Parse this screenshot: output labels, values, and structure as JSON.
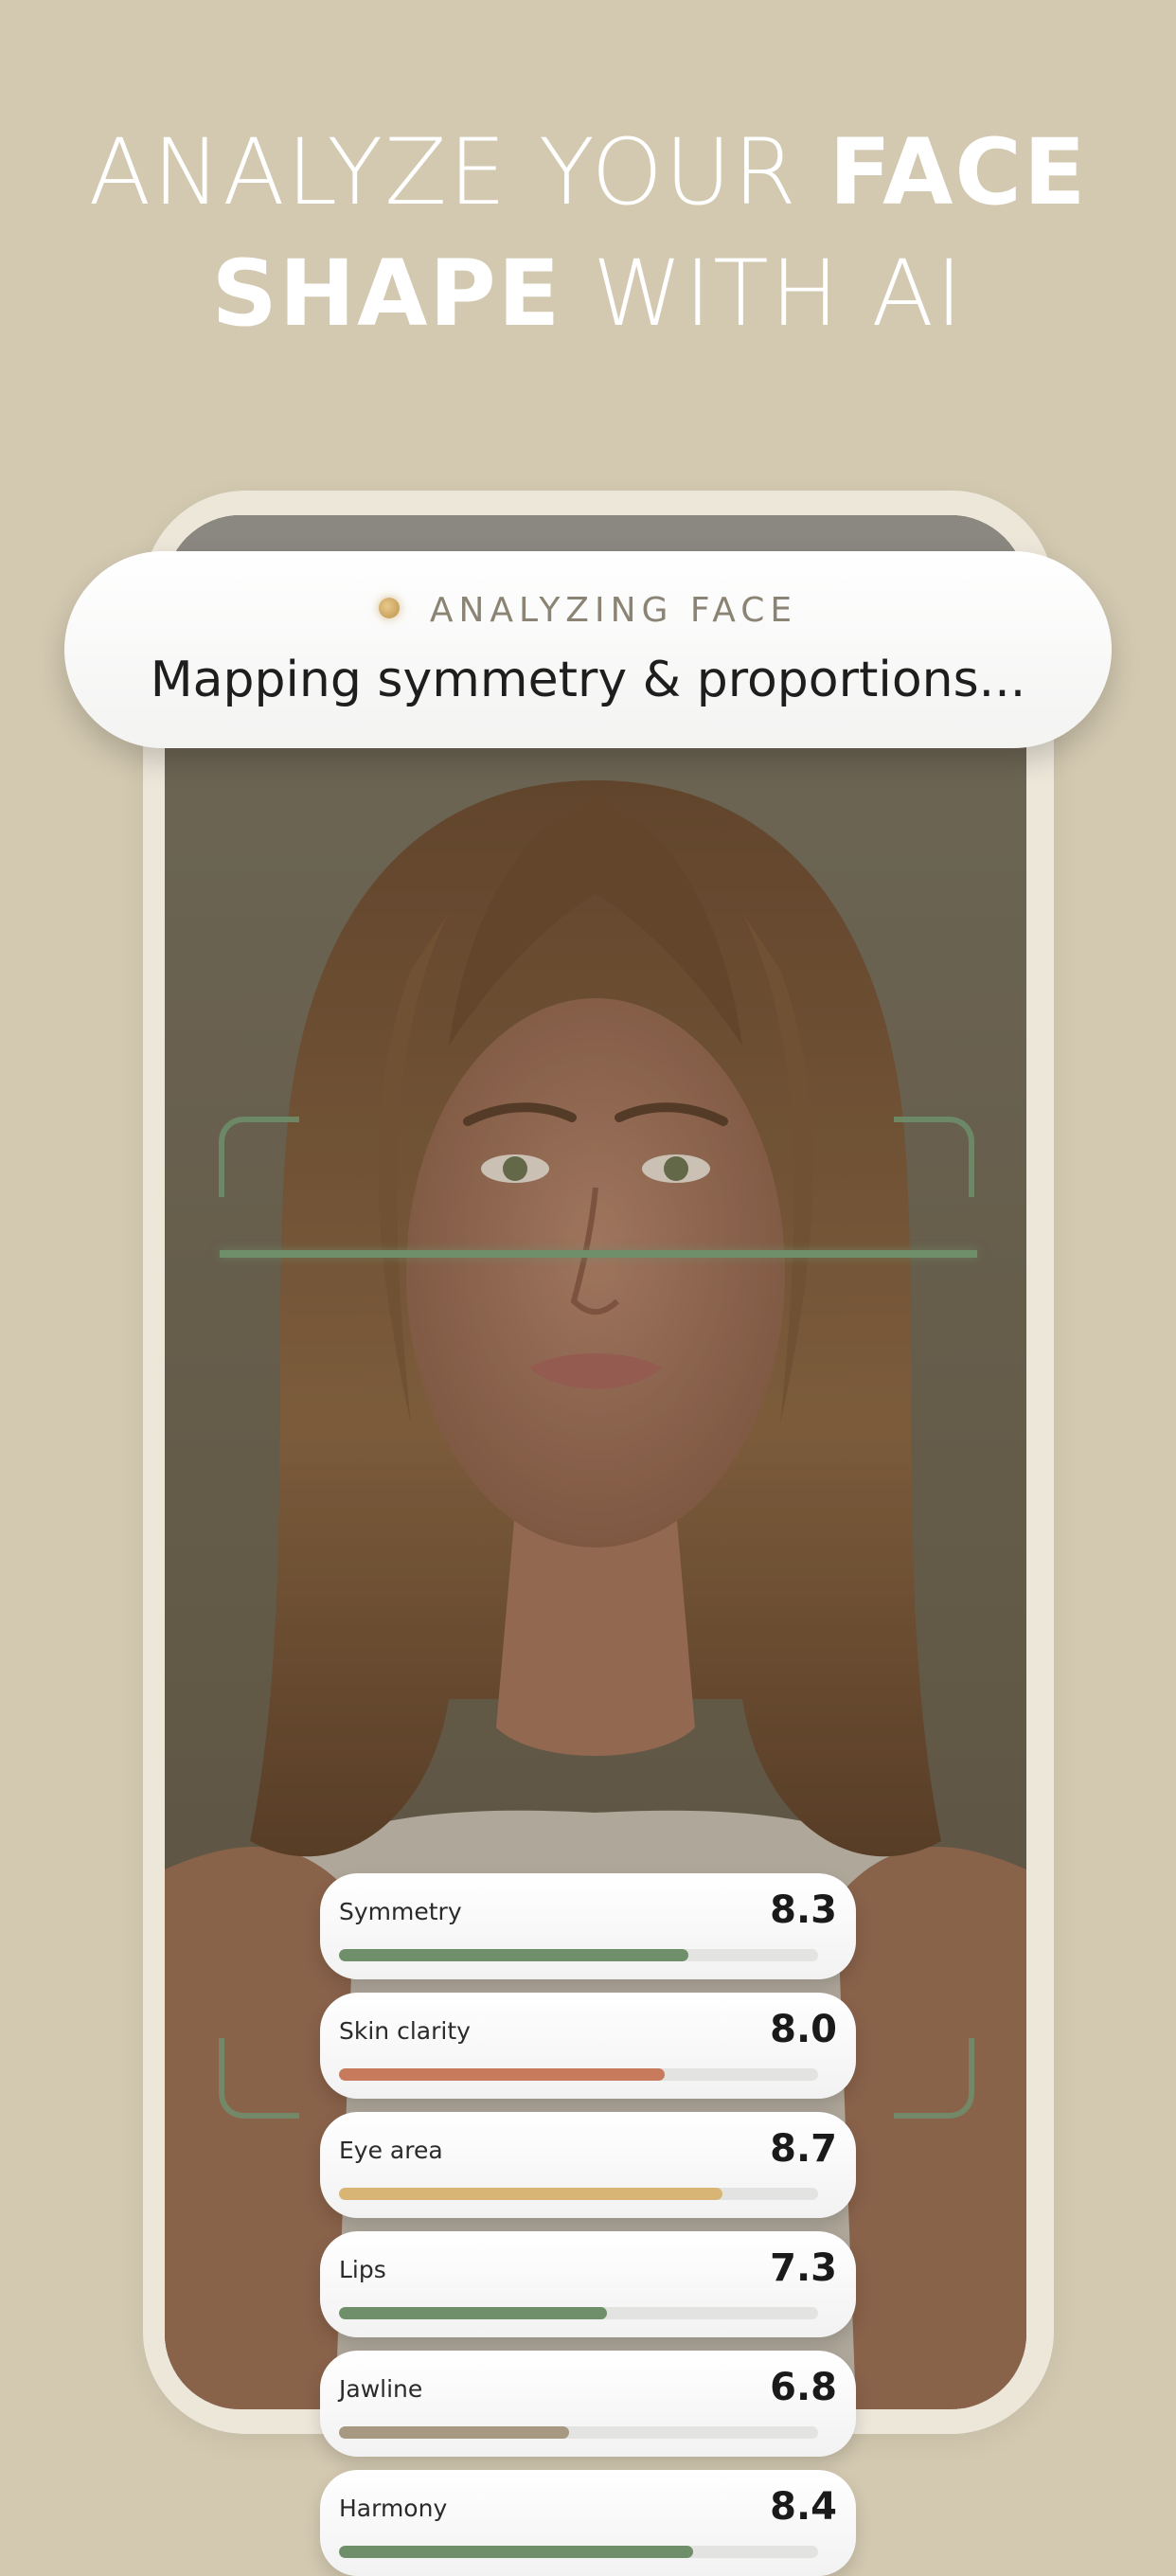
{
  "headline": {
    "line1_light": "ANALYZE YOUR ",
    "line1_bold": "FACE",
    "line2_bold": "SHAPE",
    "line2_light": " WITH AI"
  },
  "analysis": {
    "status": "ANALYZING FACE",
    "subtitle": "Mapping symmetry & proportions..."
  },
  "metrics": [
    {
      "label": "Symmetry",
      "value": "8.3",
      "fill_fraction": 0.73,
      "color": "#6f8f6b"
    },
    {
      "label": "Skin clarity",
      "value": "8.0",
      "fill_fraction": 0.68,
      "color": "#c77a5c"
    },
    {
      "label": "Eye area",
      "value": "8.7",
      "fill_fraction": 0.8,
      "color": "#d8b575"
    },
    {
      "label": "Lips",
      "value": "7.3",
      "fill_fraction": 0.56,
      "color": "#6f8f6b"
    },
    {
      "label": "Jawline",
      "value": "6.8",
      "fill_fraction": 0.48,
      "color": "#a79881"
    },
    {
      "label": "Harmony",
      "value": "8.4",
      "fill_fraction": 0.74,
      "color": "#6f8f6b"
    }
  ],
  "colors": {
    "background": "#d3c9b1",
    "frame": "#ede7da",
    "accent_green": "#6f8f6b"
  }
}
